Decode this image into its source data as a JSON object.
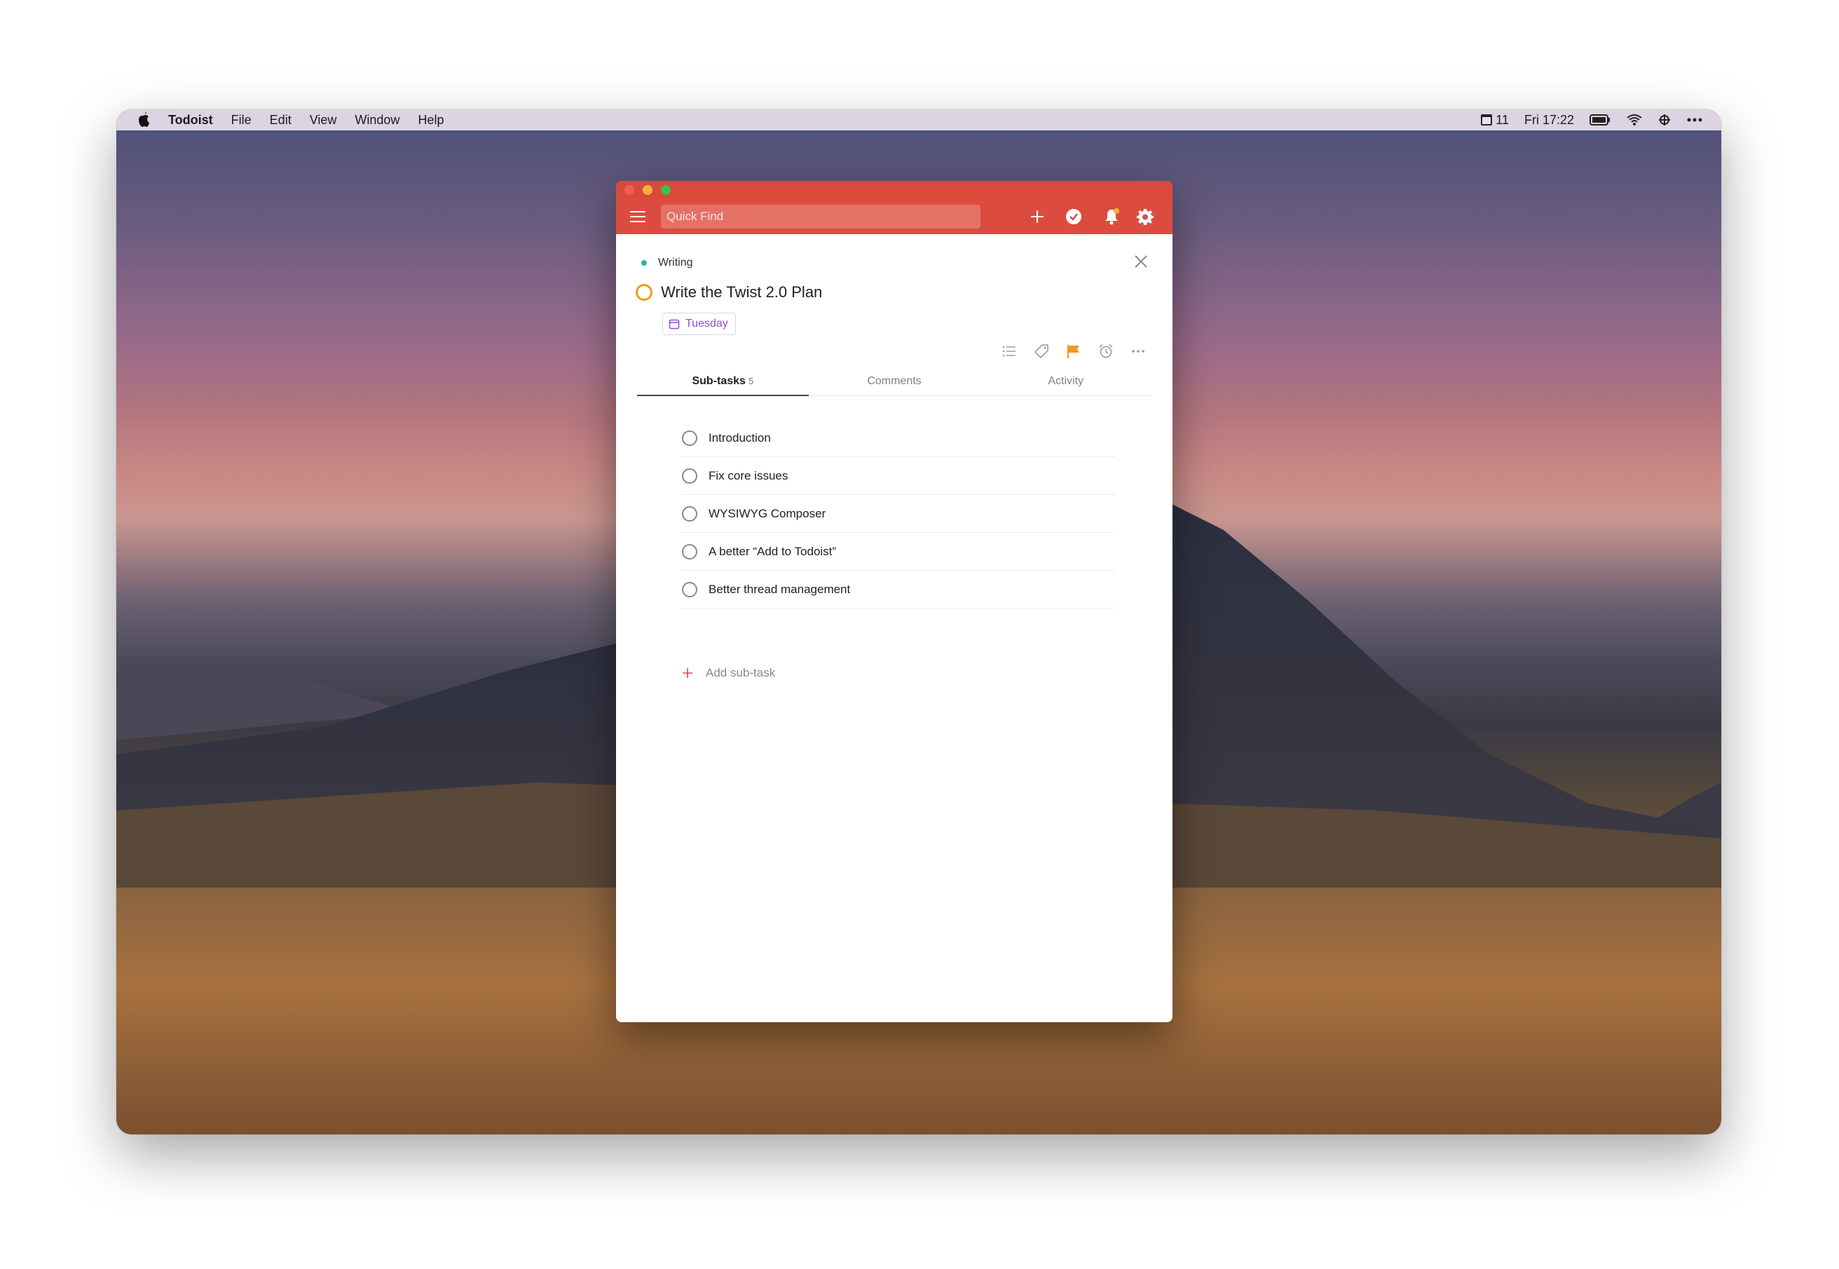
{
  "menubar": {
    "app_name": "Todoist",
    "items": [
      "File",
      "Edit",
      "View",
      "Window",
      "Help"
    ],
    "status_battery_text": "11",
    "clock": "Fri 17:22"
  },
  "toolbar": {
    "quick_find_placeholder": "Quick Find"
  },
  "task": {
    "project": "Writing",
    "title": "Write the Twist 2.0 Plan",
    "due_date": "Tuesday"
  },
  "tabs": [
    {
      "label": "Sub-tasks",
      "count": "5"
    },
    {
      "label": "Comments"
    },
    {
      "label": "Activity"
    }
  ],
  "subtasks": [
    "Introduction",
    "Fix core issues",
    "WYSIWYG Composer",
    "A better “Add to Todoist”",
    "Better thread management"
  ],
  "add_subtask_label": "Add sub-task",
  "colors": {
    "brand_red": "#db4c3f",
    "priority_orange": "#f09b1f",
    "date_purple": "#8a4fd6",
    "project_teal": "#2bb5a8"
  }
}
